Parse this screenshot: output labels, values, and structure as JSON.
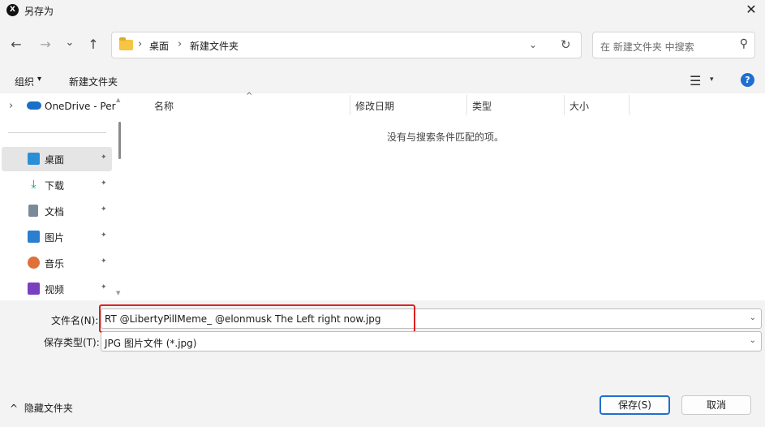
{
  "window": {
    "title": "另存为",
    "app_icon": "X",
    "close_glyph": "✕"
  },
  "nav": {
    "back_icon": "←",
    "forward_icon": "→",
    "recent_icon": "⌄",
    "up_icon": "↑",
    "breadcrumbs": [
      "桌面",
      "新建文件夹"
    ],
    "crumb_sep": "›",
    "dropdown_icon": "⌄",
    "refresh_icon": "↻",
    "search_placeholder": "在 新建文件夹 中搜索",
    "search_icon": "⚲"
  },
  "command_bar": {
    "organize_label": "组织",
    "organize_caret": "▾",
    "new_folder_label": "新建文件夹",
    "view_icon": "☰",
    "view_caret": "▾",
    "help_icon": "?"
  },
  "sidebar": {
    "top_item": {
      "label": "OneDrive - Per",
      "chevron": "›"
    },
    "items": [
      {
        "label": "桌面",
        "icon": "desktop-icon",
        "color": "#2b8fd8",
        "selected": true
      },
      {
        "label": "下载",
        "icon": "download-icon",
        "color": "#1a9b6a",
        "selected": false
      },
      {
        "label": "文档",
        "icon": "document-icon",
        "color": "#7a8a9a",
        "selected": false
      },
      {
        "label": "图片",
        "icon": "picture-icon",
        "color": "#2a7fd0",
        "selected": false
      },
      {
        "label": "音乐",
        "icon": "music-icon",
        "color": "#e0703a",
        "selected": false
      },
      {
        "label": "视频",
        "icon": "video-icon",
        "color": "#7a3fc0",
        "selected": false
      }
    ],
    "pin_glyph": "📌"
  },
  "file_list": {
    "columns": [
      "名称",
      "修改日期",
      "类型",
      "大小"
    ],
    "sort_caret": "^",
    "empty_message": "没有与搜索条件匹配的项。"
  },
  "form": {
    "filename_label": "文件名(N):",
    "filename_value": "RT @LibertyPillMeme_ @elonmusk The Left right now.jpg",
    "filetype_label": "保存类型(T):",
    "filetype_value": "JPG 图片文件 (*.jpg)",
    "caret": "⌄"
  },
  "footer": {
    "hide_folders_caret": "^",
    "hide_folders_label": "隐藏文件夹",
    "save_label": "保存(S)",
    "cancel_label": "取消"
  },
  "colors": {
    "accent": "#1f6fd0",
    "highlight_box": "#e02020",
    "folder": "#f5c543"
  }
}
